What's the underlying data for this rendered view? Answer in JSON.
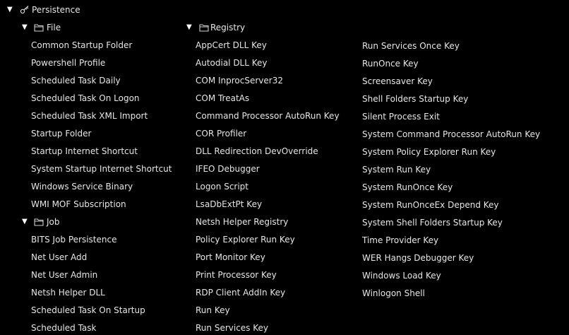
{
  "root": {
    "label": "Persistence",
    "expanded_glyph": "▼",
    "icon": "key-icon"
  },
  "groups": {
    "file": {
      "label": "File",
      "expanded_glyph": "▼",
      "icon": "folder-icon",
      "items": [
        "Common Startup Folder",
        "Powershell Profile",
        "Scheduled Task Daily",
        "Scheduled Task On Logon",
        "Scheduled Task XML Import",
        "Startup Folder",
        "Startup Internet Shortcut",
        "System Startup Internet Shortcut",
        "Windows Service Binary",
        "WMI MOF Subscription"
      ]
    },
    "job": {
      "label": "Job",
      "expanded_glyph": "▼",
      "icon": "folder-icon",
      "items": [
        "BITS Job Persistence",
        "Net User Add",
        "Net User Admin",
        "Netsh Helper DLL",
        "Scheduled Task On Startup",
        "Scheduled Task"
      ]
    },
    "registry": {
      "label": "Registry",
      "expanded_glyph": "▼",
      "icon": "folder-icon",
      "items_col1": [
        "AppCert DLL Key",
        "Autodial DLL Key",
        "COM InprocServer32",
        "COM TreatAs",
        "Command Processor AutoRun Key",
        "COR Profiler",
        "DLL Redirection DevOverride",
        "IFEO Debugger",
        "Logon Script",
        "LsaDbExtPt Key",
        "Netsh Helper Registry",
        "Policy Explorer Run Key",
        "Port Monitor Key",
        "Print Processor Key",
        "RDP Client AddIn Key",
        "Run Key",
        "Run Services Key"
      ],
      "items_col2": [
        "Run Services Once Key",
        "RunOnce Key",
        "Screensaver Key",
        "Shell Folders Startup Key",
        "Silent Process Exit",
        "System Command Processor AutoRun Key",
        "System Policy Explorer Run Key",
        "System Run Key",
        "System RunOnce Key",
        "System RunOnceEx Depend Key",
        "System Shell Folders Startup Key",
        "Time Provider Key",
        "WER Hangs Debugger Key",
        "Windows Load Key",
        "Winlogon Shell"
      ]
    }
  },
  "colors": {
    "background": "#000000",
    "text": "#e6e6e6",
    "icon": "#d0d0d0"
  }
}
